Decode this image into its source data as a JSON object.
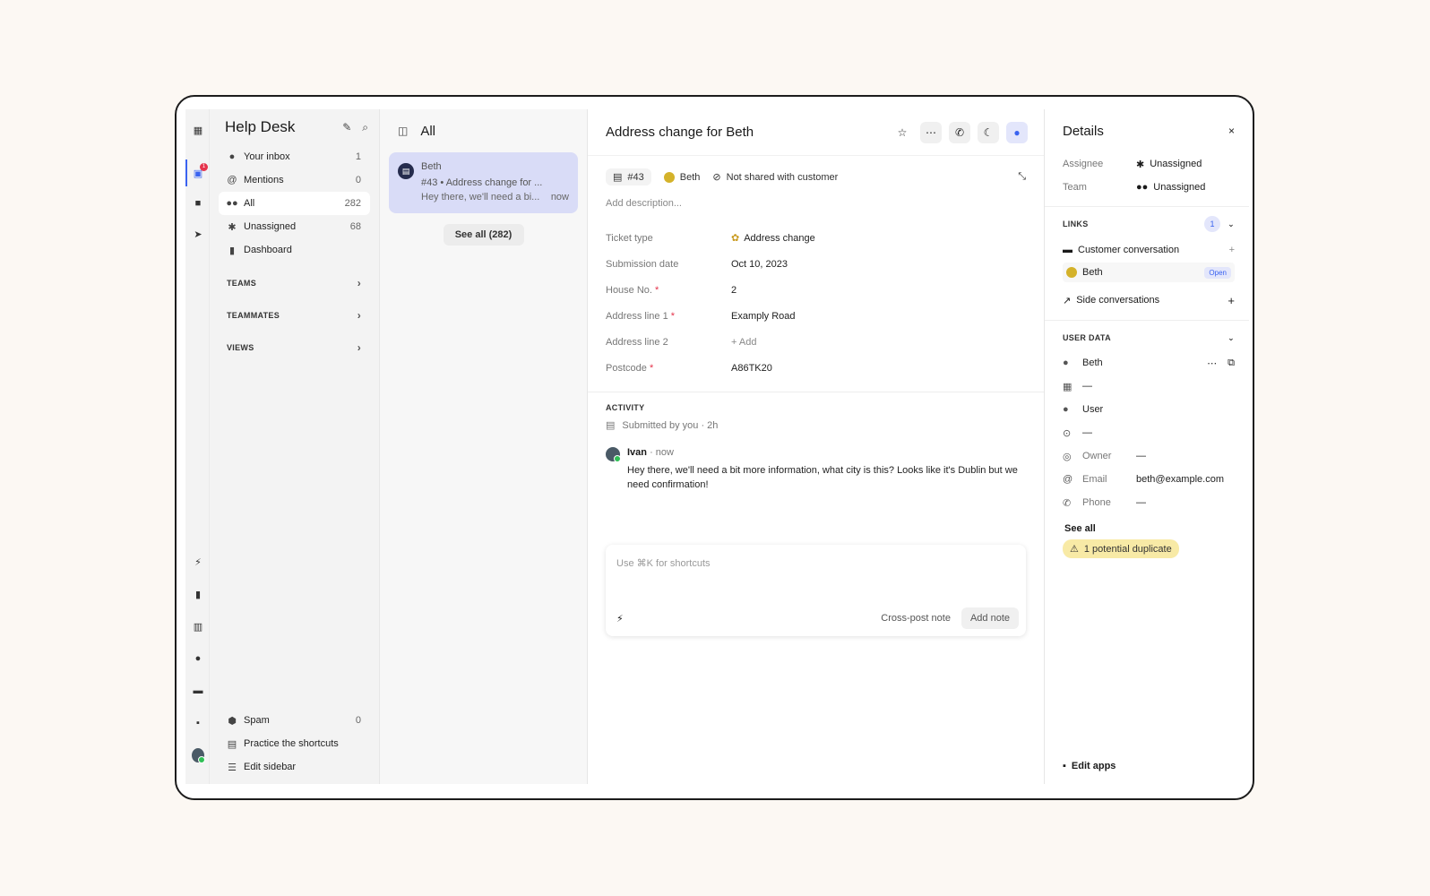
{
  "rail": {
    "inbox_badge": "1"
  },
  "nav": {
    "title": "Help Desk",
    "items": [
      {
        "label": "Your inbox",
        "count": "1"
      },
      {
        "label": "Mentions",
        "count": "0"
      },
      {
        "label": "All",
        "count": "282"
      },
      {
        "label": "Unassigned",
        "count": "68"
      },
      {
        "label": "Dashboard",
        "count": ""
      }
    ],
    "sections": [
      "TEAMS",
      "TEAMMATES",
      "VIEWS"
    ],
    "bottom": [
      {
        "label": "Spam",
        "count": "0"
      },
      {
        "label": "Practice the shortcuts",
        "count": ""
      },
      {
        "label": "Edit sidebar",
        "count": ""
      }
    ]
  },
  "list": {
    "title": "All",
    "card": {
      "name": "Beth",
      "subject": "#43 • Address change for ...",
      "preview": "Hey there, we'll need a bi...",
      "time": "now"
    },
    "see_all": "See all (282)"
  },
  "ticket": {
    "title": "Address change for Beth",
    "id": "#43",
    "customer": "Beth",
    "shared": "Not shared with customer",
    "description_placeholder": "Add description...",
    "attributes": [
      {
        "key": "Ticket type",
        "value": "Address change",
        "required": false
      },
      {
        "key": "Submission date",
        "value": "Oct 10, 2023",
        "required": false
      },
      {
        "key": "House No.",
        "value": "2",
        "required": true
      },
      {
        "key": "Address line 1",
        "value": "Examply Road",
        "required": true
      },
      {
        "key": "Address line 2",
        "value": "+ Add",
        "required": false
      },
      {
        "key": "Postcode",
        "value": "A86TK20",
        "required": true
      }
    ],
    "activity_label": "ACTIVITY",
    "submitted": "Submitted by you · 2h",
    "message": {
      "author": "Ivan",
      "time": "· now",
      "body": "Hey there, we'll need a bit more information, what city is this? Looks like it's Dublin but we need confirmation!"
    },
    "composer": {
      "placeholder": "Use ⌘K for shortcuts",
      "crosspost": "Cross-post note",
      "add": "Add note"
    }
  },
  "details": {
    "title": "Details",
    "assignee_label": "Assignee",
    "assignee": "Unassigned",
    "team_label": "Team",
    "team": "Unassigned",
    "links_label": "LINKS",
    "links_count": "1",
    "customer_conv": "Customer conversation",
    "linked_name": "Beth",
    "linked_status": "Open",
    "side_conv": "Side conversations",
    "user_data_label": "USER DATA",
    "user_rows": [
      {
        "key": "",
        "value": "Beth"
      },
      {
        "key": "",
        "value": "—"
      },
      {
        "key": "",
        "value": "User"
      },
      {
        "key": "",
        "value": "—"
      },
      {
        "key": "Owner",
        "value": "—"
      },
      {
        "key": "Email",
        "value": "beth@example.com"
      },
      {
        "key": "Phone",
        "value": "—"
      }
    ],
    "see_all": "See all",
    "duplicate": "1 potential duplicate",
    "edit_apps": "Edit apps"
  }
}
